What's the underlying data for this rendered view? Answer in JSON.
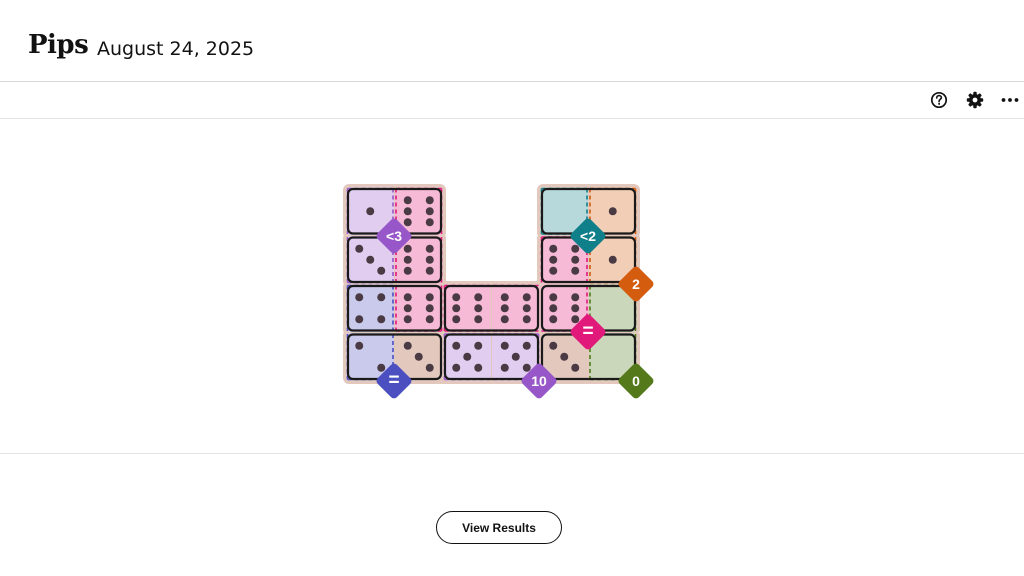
{
  "header": {
    "logo": "Pips",
    "date": "August 24, 2025"
  },
  "toolbar": {
    "icons": [
      "help-icon",
      "settings-gear-icon",
      "more-options-icon"
    ]
  },
  "footer": {
    "view_results_label": "View Results"
  },
  "colors": {
    "board_bg": "#e3c8be",
    "purple": "#9757c8",
    "pink": "#e0197a",
    "teal": "#0f7f8a",
    "orange": "#d35c0f",
    "indigo": "#4b4fc0",
    "green": "#53791b"
  },
  "regions": [
    {
      "color": "purple",
      "label": "<3",
      "cells": [
        [
          0,
          0
        ],
        [
          1,
          0
        ]
      ]
    },
    {
      "color": "pink",
      "label": "",
      "cells": [
        [
          0,
          1
        ],
        [
          1,
          1
        ],
        [
          2,
          1
        ]
      ]
    },
    {
      "color": "teal",
      "label": "<2",
      "cells": [
        [
          0,
          4
        ]
      ]
    },
    {
      "color": "orange",
      "label": "2",
      "cells": [
        [
          0,
          5
        ],
        [
          1,
          5
        ]
      ]
    },
    {
      "color": "pink",
      "label": "=",
      "cells": [
        [
          1,
          4
        ],
        [
          2,
          2
        ],
        [
          2,
          3
        ],
        [
          2,
          4
        ]
      ]
    },
    {
      "color": "green",
      "label": "0",
      "cells": [
        [
          2,
          5
        ],
        [
          3,
          5
        ]
      ]
    },
    {
      "color": "indigo",
      "label": "=",
      "cells": [
        [
          2,
          0
        ],
        [
          3,
          0
        ]
      ]
    },
    {
      "color": "purple",
      "label": "10",
      "cells": [
        [
          3,
          2
        ],
        [
          3,
          3
        ]
      ]
    }
  ],
  "dominoes": [
    {
      "a": [
        0,
        0
      ],
      "b": [
        0,
        1
      ],
      "pips": [
        1,
        6
      ]
    },
    {
      "a": [
        1,
        0
      ],
      "b": [
        1,
        1
      ],
      "pips": [
        3,
        6
      ]
    },
    {
      "a": [
        2,
        0
      ],
      "b": [
        2,
        1
      ],
      "pips": [
        4,
        6
      ]
    },
    {
      "a": [
        3,
        0
      ],
      "b": [
        3,
        1
      ],
      "pips": [
        2,
        3
      ]
    },
    {
      "a": [
        2,
        2
      ],
      "b": [
        2,
        3
      ],
      "pips": [
        6,
        6
      ]
    },
    {
      "a": [
        3,
        2
      ],
      "b": [
        3,
        3
      ],
      "pips": [
        5,
        5
      ]
    },
    {
      "a": [
        0,
        4
      ],
      "b": [
        0,
        5
      ],
      "pips": [
        0,
        1
      ]
    },
    {
      "a": [
        1,
        4
      ],
      "b": [
        1,
        5
      ],
      "pips": [
        6,
        1
      ]
    },
    {
      "a": [
        2,
        4
      ],
      "b": [
        2,
        5
      ],
      "pips": [
        6,
        0
      ]
    },
    {
      "a": [
        3,
        4
      ],
      "b": [
        3,
        5
      ],
      "pips": [
        3,
        0
      ]
    }
  ]
}
